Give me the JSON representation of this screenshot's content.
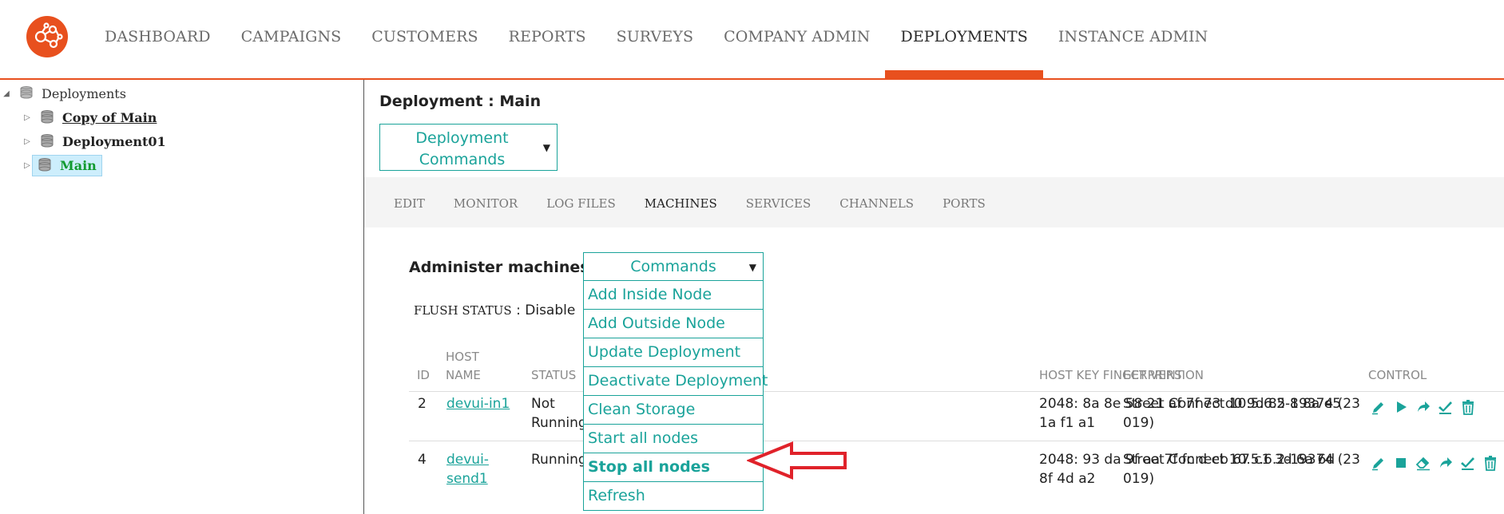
{
  "nav": {
    "items": [
      "DASHBOARD",
      "CAMPAIGNS",
      "CUSTOMERS",
      "REPORTS",
      "SURVEYS",
      "COMPANY ADMIN",
      "DEPLOYMENTS",
      "INSTANCE ADMIN"
    ],
    "active": "DEPLOYMENTS"
  },
  "tree": {
    "root": "Deployments",
    "children": [
      "Copy of Main",
      "Deployment01",
      "Main"
    ],
    "selected": "Main"
  },
  "deployment": {
    "title": "Deployment : Main",
    "commands_label": "Deployment Commands"
  },
  "tabs": [
    "EDIT",
    "MONITOR",
    "LOG FILES",
    "MACHINES",
    "SERVICES",
    "CHANNELS",
    "PORTS"
  ],
  "active_tab": "MACHINES",
  "machines": {
    "title": "Administer machines",
    "flush_label": "FLUSH STATUS",
    "flush_value": ": Disable",
    "commands_label": "Commands",
    "commands": [
      "Add Inside Node",
      "Add Outside Node",
      "Update Deployment",
      "Deactivate Deployment",
      "Clean Storage",
      "Start all nodes",
      "Stop all nodes",
      "Refresh"
    ],
    "highlighted_command": "Stop all nodes",
    "columns": {
      "id": "ID",
      "host_name_1": "HOST",
      "host_name_2": "NAME",
      "status": "STATUS",
      "version": "ECT VERSION",
      "fingerprint": "HOST KEY FINGERPRINT",
      "control": "CONTROL"
    },
    "rows": [
      {
        "id": "2",
        "host": "devui-in1",
        "status_1": "Not",
        "status_2": "Running",
        "version_1": "Street Connect 10.5.6.2-19374 (23",
        "version_2": "019)",
        "fp_1": "2048: 8a 8e 58 21 af 7f 73 d0 9d 85 8 8a e5",
        "fp_2": "1a f1 a1",
        "controls": [
          "pencil-icon",
          "play-icon",
          "redirect-icon",
          "check-icon",
          "trash-icon"
        ]
      },
      {
        "id": "4",
        "host_1": "devui-",
        "host_2": "send1",
        "status_1": "Running",
        "version_1": "Street Connect 10.5.6.2-19374 (23",
        "version_2": "019)",
        "fp_1": "2048: 93 da 9f aa 7f fc d eb 67 c1 3d 6a 6d",
        "fp_2": "8f 4d a2",
        "controls": [
          "pencil-icon",
          "stop-icon",
          "eraser-icon",
          "redirect-icon",
          "check-icon",
          "trash-icon"
        ]
      }
    ]
  },
  "colors": {
    "accent": "#e8501e",
    "teal": "#1aa39a",
    "arrow": "#e0222a"
  }
}
